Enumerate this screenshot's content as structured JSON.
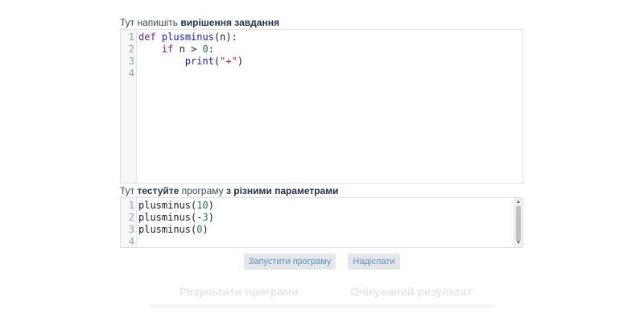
{
  "solution_label": {
    "prefix": "Тут напишіть ",
    "bold": "вирішення завдання"
  },
  "solution_editor": {
    "line_numbers": [
      "1",
      "2",
      "3",
      "4"
    ],
    "lines": [
      {
        "indent": "",
        "tokens": [
          {
            "t": "def",
            "c": "kw"
          },
          {
            "t": " "
          },
          {
            "t": "plusminus",
            "c": "fn"
          },
          {
            "t": "(n):"
          }
        ]
      },
      {
        "indent": "    ",
        "tokens": [
          {
            "t": "if",
            "c": "kw2"
          },
          {
            "t": " n > "
          },
          {
            "t": "0",
            "c": "num"
          },
          {
            "t": ":"
          }
        ]
      },
      {
        "indent": "        ",
        "tokens": [
          {
            "t": "print",
            "c": "fn"
          },
          {
            "t": "("
          },
          {
            "t": "\"+\"",
            "c": "str"
          },
          {
            "t": ")"
          }
        ]
      },
      {
        "indent": "",
        "tokens": []
      }
    ]
  },
  "test_label": {
    "p1": "Тут ",
    "b1": "тестуйте",
    "p2": " програму ",
    "b2": "з різними параметрами"
  },
  "test_editor": {
    "line_numbers": [
      "1",
      "2",
      "3",
      "4"
    ],
    "lines": [
      {
        "indent": "",
        "tokens": [
          {
            "t": "plusminus("
          },
          {
            "t": "10",
            "c": "num"
          },
          {
            "t": ")"
          }
        ]
      },
      {
        "indent": "",
        "tokens": [
          {
            "t": "plusminus(-"
          },
          {
            "t": "3",
            "c": "num"
          },
          {
            "t": ")"
          }
        ]
      },
      {
        "indent": "",
        "tokens": [
          {
            "t": "plusminus("
          },
          {
            "t": "0",
            "c": "num"
          },
          {
            "t": ")"
          }
        ]
      },
      {
        "indent": "",
        "tokens": []
      }
    ]
  },
  "buttons": {
    "run": "Запустити програму",
    "submit": "Надіслати"
  },
  "results": {
    "program_output": "Результати програми",
    "expected_output": "Очікуваний результат"
  },
  "icons": {
    "scroll_up": "scroll-up-arrow-icon",
    "scroll_down": "scroll-down-arrow-icon"
  }
}
